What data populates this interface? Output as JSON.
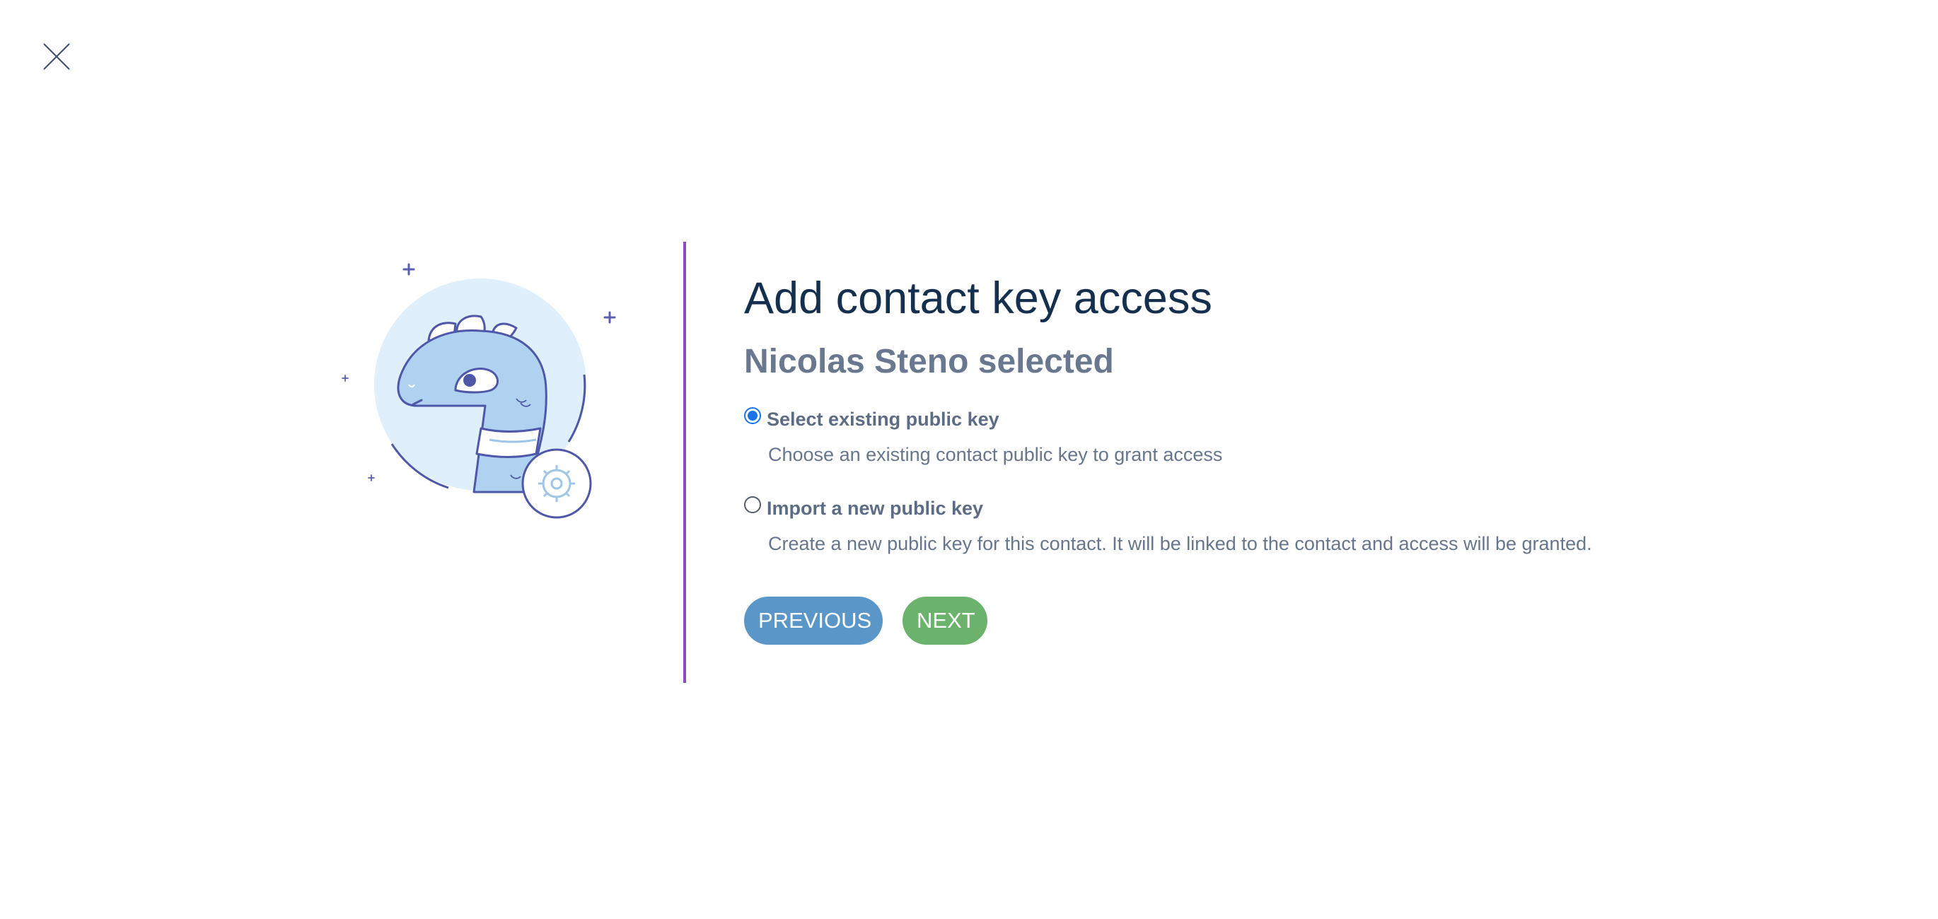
{
  "header": {
    "close_icon": "close-icon"
  },
  "illustration": {
    "icon": "dinosaur-with-gear-illustration"
  },
  "dialog": {
    "title": "Add contact key access",
    "subtitle": "Nicolas Steno selected",
    "options": [
      {
        "label": "Select existing public key",
        "description": "Choose an existing contact public key to grant access",
        "checked": true
      },
      {
        "label": "Import a new public key",
        "description": "Create a new public key for this contact. It will be linked to the contact and access will be granted.",
        "checked": false
      }
    ],
    "buttons": {
      "previous_label": "PREVIOUS",
      "next_label": "NEXT"
    }
  },
  "colors": {
    "title": "#15304f",
    "subtitle": "#69788f",
    "divider": "#8a4bbf",
    "previous_button": "#5b96c8",
    "next_button": "#6bb36c"
  }
}
